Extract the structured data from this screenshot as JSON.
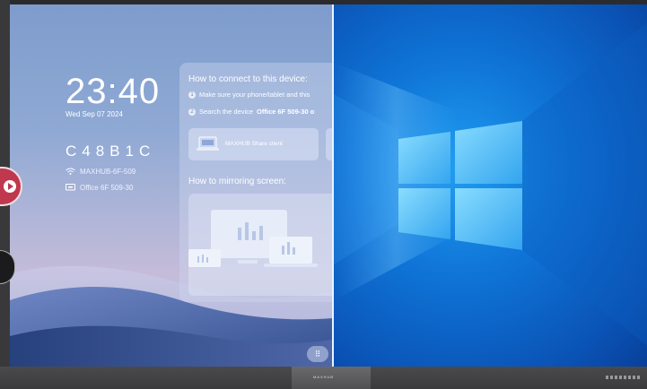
{
  "clock": {
    "time": "23:40",
    "date": "Wed  Sep 07 2024"
  },
  "connection_code": "C48B1C",
  "network": {
    "wifi_name": "MAXHUB-6F-509",
    "device_name": "Office 6F 509-30"
  },
  "connect_panel": {
    "title": "How to connect to this device:",
    "step1": "Make sure your phone/tablet and this",
    "step2_prefix": "Search the device",
    "step2_device": "Office 6F 509-30 o",
    "share_client_label": "MAXHUB Share client",
    "mirroring_title": "How to mirroring screen:"
  },
  "bezel": {
    "brand": "MAXHUB"
  },
  "icons": {
    "wifi": "wifi-icon",
    "device": "monitor-icon",
    "laptop": "laptop-icon",
    "grid": "grid-icon",
    "play": "play-icon"
  },
  "colors": {
    "windows_blue": "#0f73d6",
    "handle_red": "#c0384e"
  }
}
